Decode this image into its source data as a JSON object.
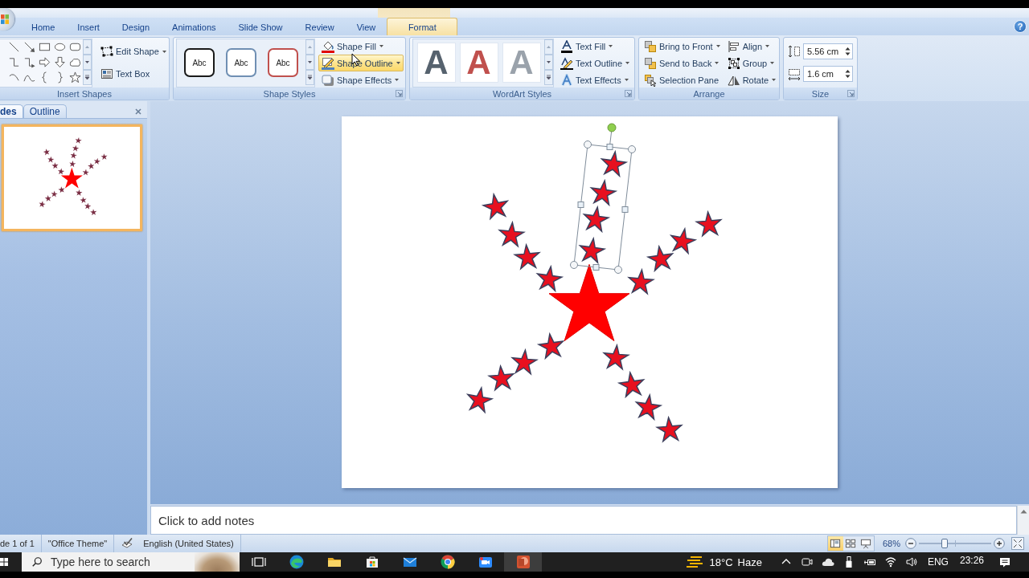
{
  "ribbon_tabs": [
    {
      "label": "Home",
      "selected": false
    },
    {
      "label": "Insert",
      "selected": false
    },
    {
      "label": "Design",
      "selected": false
    },
    {
      "label": "Animations",
      "selected": false
    },
    {
      "label": "Slide Show",
      "selected": false
    },
    {
      "label": "Review",
      "selected": false
    },
    {
      "label": "View",
      "selected": false
    },
    {
      "label": "Format",
      "selected": true
    }
  ],
  "help_button": {
    "label": "?"
  },
  "ribbon_groups": [
    {
      "kind": "insert-shapes",
      "title": "Insert Shapes",
      "launcher": false,
      "commands": [
        {
          "kind": "edit-shape",
          "label": "Edit Shape",
          "dropdown": true,
          "hovered": false
        },
        {
          "kind": "text-box",
          "label": "Text Box",
          "dropdown": false,
          "hovered": false
        }
      ]
    },
    {
      "kind": "shape-styles",
      "title": "Shape Styles",
      "launcher": true,
      "styles": [
        {
          "label": "Abc",
          "color": "#1a1a1a"
        },
        {
          "label": "Abc",
          "color": "#6f8fb3"
        },
        {
          "label": "Abc",
          "color": "#c0504d"
        }
      ],
      "commands": [
        {
          "kind": "shape-fill",
          "label": "Shape Fill",
          "dropdown": true,
          "hovered": false
        },
        {
          "kind": "shape-outline",
          "label": "Shape Outline",
          "dropdown": true,
          "hovered": true
        },
        {
          "kind": "shape-effects",
          "label": "Shape Effects",
          "dropdown": true,
          "hovered": false
        }
      ]
    },
    {
      "kind": "wordart-styles",
      "title": "WordArt Styles",
      "launcher": true,
      "styles": [
        {
          "label": "A",
          "color": "#56626e"
        },
        {
          "label": "A",
          "color": "#c0504d"
        },
        {
          "label": "A",
          "color": "#9aa2ab"
        }
      ],
      "commands": [
        {
          "kind": "text-fill",
          "label": "Text Fill",
          "dropdown": true,
          "hovered": false
        },
        {
          "kind": "text-outline",
          "label": "Text Outline",
          "dropdown": true,
          "hovered": false
        },
        {
          "kind": "text-effects",
          "label": "Text Effects",
          "dropdown": true,
          "hovered": false
        }
      ]
    },
    {
      "kind": "arrange",
      "title": "Arrange",
      "launcher": false,
      "commands": [
        {
          "kind": "bring-to-front",
          "label": "Bring to Front",
          "dropdown": true,
          "hovered": false
        },
        {
          "kind": "send-to-back",
          "label": "Send to Back",
          "dropdown": true,
          "hovered": false
        },
        {
          "kind": "selection-pane",
          "label": "Selection Pane",
          "dropdown": false,
          "hovered": false
        },
        {
          "kind": "align",
          "label": "Align",
          "dropdown": true,
          "hovered": false
        },
        {
          "kind": "group",
          "label": "Group",
          "dropdown": true,
          "hovered": false
        },
        {
          "kind": "rotate",
          "label": "Rotate",
          "dropdown": true,
          "hovered": false
        }
      ]
    },
    {
      "kind": "size",
      "title": "Size",
      "launcher": true,
      "fields": [
        {
          "kind": "height",
          "value": "5.56 cm"
        },
        {
          "kind": "width",
          "value": "1.6 cm"
        }
      ]
    }
  ],
  "slides_panel": {
    "tabs": [
      {
        "label": "des",
        "selected": true
      },
      {
        "label": "Outline",
        "selected": false
      }
    ],
    "thumbnails": [
      {
        "selected": true
      }
    ]
  },
  "notes": {
    "placeholder": "Click to add notes"
  },
  "status_bar": {
    "slide_info": "de 1 of 1",
    "theme": "\"Office Theme\"",
    "language": "English (United States)",
    "views": [
      {
        "kind": "normal",
        "selected": true
      },
      {
        "kind": "sorter",
        "selected": false
      },
      {
        "kind": "show",
        "selected": false
      }
    ],
    "zoom": "68%",
    "zoom_slider": {
      "level": 0.35
    }
  },
  "taskbar": {
    "search": {
      "placeholder": "Type here to search"
    },
    "apps": [
      {
        "kind": "task-view",
        "selected": false
      },
      {
        "kind": "edge",
        "selected": false
      },
      {
        "kind": "explorer",
        "selected": false
      },
      {
        "kind": "store",
        "selected": false
      },
      {
        "kind": "mail",
        "selected": false
      },
      {
        "kind": "chrome",
        "selected": false
      },
      {
        "kind": "camera",
        "selected": false
      },
      {
        "kind": "powerpoint",
        "selected": true
      }
    ],
    "weather": {
      "temperature": "18°C",
      "condition": "Haze"
    },
    "language": "ENG",
    "time": "23:26"
  }
}
